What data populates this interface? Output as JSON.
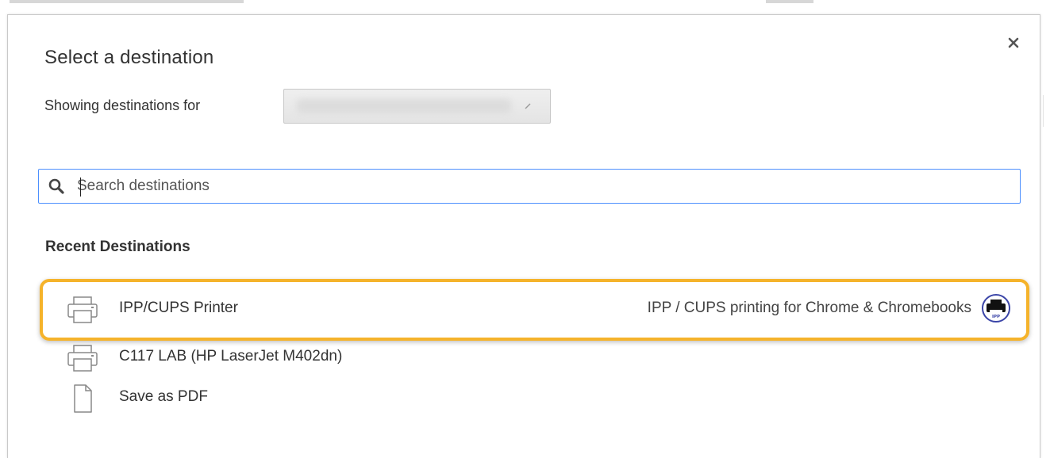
{
  "dialog": {
    "title": "Select a destination",
    "close_icon": "close-icon"
  },
  "account": {
    "label": "Showing destinations for",
    "selected_value": ""
  },
  "search": {
    "placeholder": "Search destinations",
    "value": "",
    "icon": "search-icon"
  },
  "recent": {
    "heading": "Recent Destinations",
    "items": [
      {
        "name": "IPP/CUPS Printer",
        "description": "IPP / CUPS printing for Chrome & Chromebooks",
        "icon": "printer-icon",
        "badge": "IPP",
        "highlighted": true
      },
      {
        "name": "C117 LAB (HP LaserJet M402dn)",
        "description": "",
        "icon": "printer-icon"
      },
      {
        "name": "Save as PDF",
        "description": "",
        "icon": "document-icon"
      }
    ]
  },
  "colors": {
    "highlight": "#f5b32b",
    "focus_border": "#4d90fe",
    "badge_ring": "#3b45a8"
  }
}
